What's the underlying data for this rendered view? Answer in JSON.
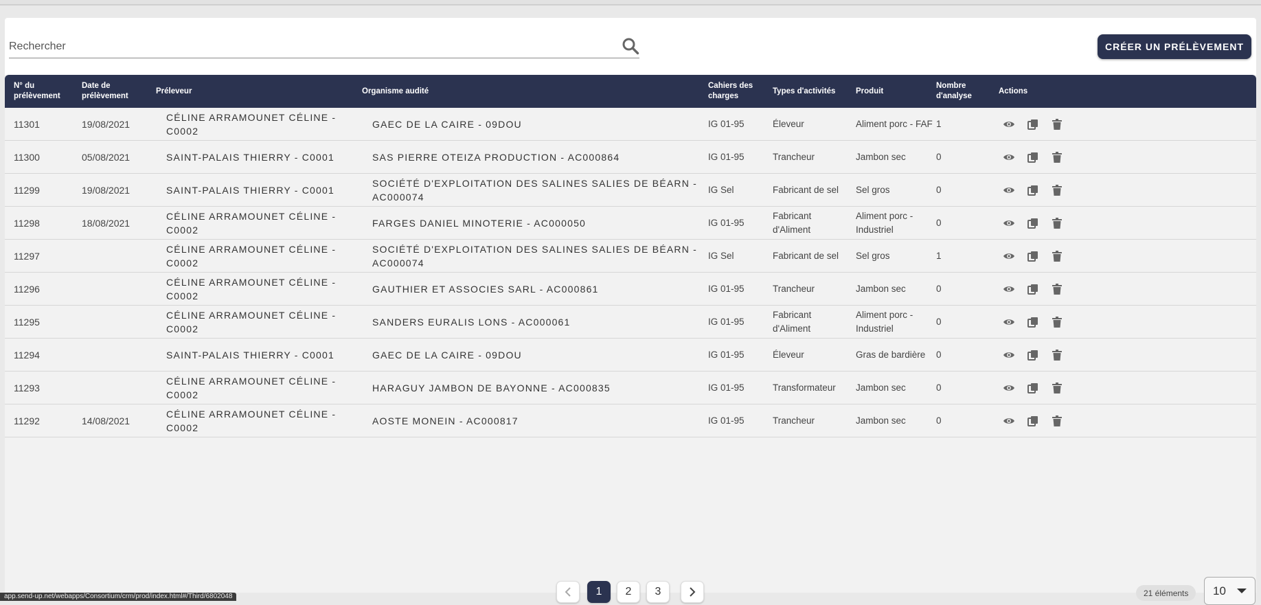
{
  "search": {
    "placeholder": "Rechercher",
    "value": ""
  },
  "toolbar": {
    "create_label": "CRÉER UN PRÉLÈVEMENT"
  },
  "columns": [
    "N° du prélèvement",
    "Date de prélèvement",
    "Préleveur",
    "Organisme audité",
    "Cahiers des charges",
    "Types d'activités",
    "Produit",
    "Nombre d'analyse",
    "Actions"
  ],
  "rows": [
    {
      "id": "11301",
      "date": "19/08/2021",
      "preleveur": "CÉLINE ARRAMOUNET CÉLINE - C0002",
      "organisme": "GAEC DE LA CAIRE - 09DOU",
      "cahier": "IG 01-95",
      "activite": "Éleveur",
      "produit": "Aliment porc - FAF",
      "nb": "1"
    },
    {
      "id": "11300",
      "date": "05/08/2021",
      "preleveur": "SAINT-PALAIS THIERRY - C0001",
      "organisme": "SAS PIERRE OTEIZA PRODUCTION - AC000864",
      "cahier": "IG 01-95",
      "activite": "Trancheur",
      "produit": "Jambon sec",
      "nb": "0"
    },
    {
      "id": "11299",
      "date": "19/08/2021",
      "preleveur": "SAINT-PALAIS THIERRY - C0001",
      "organisme": "SOCIÉTÉ D'EXPLOITATION DES SALINES SALIES DE BÉARN - AC000074",
      "cahier": "IG Sel",
      "activite": "Fabricant de sel",
      "produit": "Sel gros",
      "nb": "0"
    },
    {
      "id": "11298",
      "date": "18/08/2021",
      "preleveur": "CÉLINE ARRAMOUNET CÉLINE - C0002",
      "organisme": "FARGES DANIEL MINOTERIE - AC000050",
      "cahier": "IG 01-95",
      "activite": "Fabricant d'Aliment",
      "produit": "Aliment porc - Industriel",
      "nb": "0"
    },
    {
      "id": "11297",
      "date": "",
      "preleveur": "CÉLINE ARRAMOUNET CÉLINE - C0002",
      "organisme": "SOCIÉTÉ D'EXPLOITATION DES SALINES SALIES DE BÉARN - AC000074",
      "cahier": "IG Sel",
      "activite": "Fabricant de sel",
      "produit": "Sel gros",
      "nb": "1"
    },
    {
      "id": "11296",
      "date": "",
      "preleveur": "CÉLINE ARRAMOUNET CÉLINE - C0002",
      "organisme": "GAUTHIER ET ASSOCIES SARL - AC000861",
      "cahier": "IG 01-95",
      "activite": "Trancheur",
      "produit": "Jambon sec",
      "nb": "0"
    },
    {
      "id": "11295",
      "date": "",
      "preleveur": "CÉLINE ARRAMOUNET CÉLINE - C0002",
      "organisme": "SANDERS EURALIS LONS - AC000061",
      "cahier": "IG 01-95",
      "activite": "Fabricant d'Aliment",
      "produit": "Aliment porc - Industriel",
      "nb": "0"
    },
    {
      "id": "11294",
      "date": "",
      "preleveur": "SAINT-PALAIS THIERRY - C0001",
      "organisme": "GAEC DE LA CAIRE - 09DOU",
      "cahier": "IG 01-95",
      "activite": "Éleveur",
      "produit": "Gras de bardière",
      "nb": "0"
    },
    {
      "id": "11293",
      "date": "",
      "preleveur": "CÉLINE ARRAMOUNET CÉLINE - C0002",
      "organisme": "HARAGUY JAMBON DE BAYONNE - AC000835",
      "cahier": "IG 01-95",
      "activite": "Transformateur",
      "produit": "Jambon sec",
      "nb": "0"
    },
    {
      "id": "11292",
      "date": "14/08/2021",
      "preleveur": "CÉLINE ARRAMOUNET CÉLINE - C0002",
      "organisme": "AOSTE MONEIN - AC000817",
      "cahier": "IG 01-95",
      "activite": "Trancheur",
      "produit": "Jambon sec",
      "nb": "0"
    }
  ],
  "row_actions": {
    "view": "eye-icon",
    "copy": "copy-icon",
    "delete": "trash-icon"
  },
  "pagination": {
    "pages": [
      "1",
      "2",
      "3"
    ],
    "current": "1",
    "count_label": "21 éléments",
    "page_size": "10"
  },
  "status_url": "app.send-up.net/webapps/Consortium/crm/prod/index.html#/Third/6802048",
  "colors": {
    "primary": "#2b3350",
    "row_bg": "#f2f2f2",
    "card_bg": "#ffffff"
  }
}
